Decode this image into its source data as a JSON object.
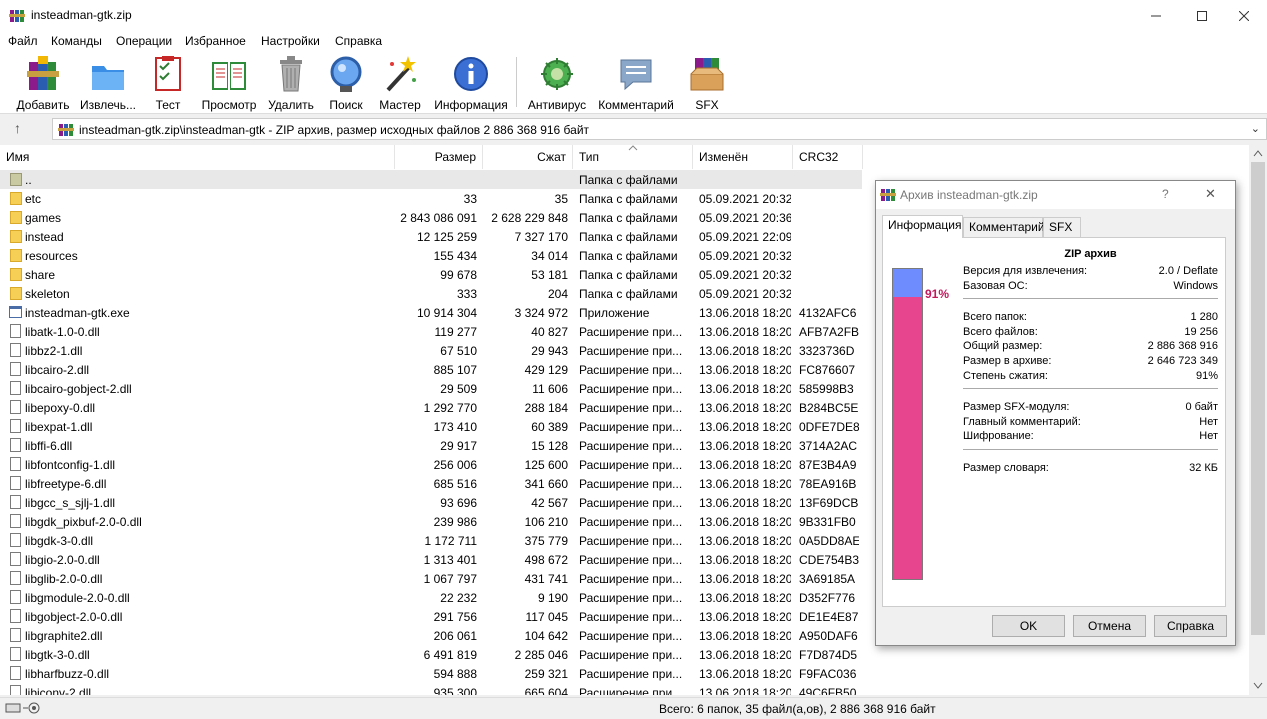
{
  "window": {
    "title": "insteadman-gtk.zip"
  },
  "menu": [
    "Файл",
    "Команды",
    "Операции",
    "Избранное",
    "Настройки",
    "Справка"
  ],
  "toolbar": [
    {
      "label": "Добавить",
      "icon": "add-archive-icon"
    },
    {
      "label": "Извлечь...",
      "icon": "extract-icon"
    },
    {
      "label": "Тест",
      "icon": "test-icon"
    },
    {
      "label": "Просмотр",
      "icon": "view-icon"
    },
    {
      "label": "Удалить",
      "icon": "delete-icon"
    },
    {
      "label": "Поиск",
      "icon": "find-icon"
    },
    {
      "label": "Мастер",
      "icon": "wizard-icon"
    },
    {
      "label": "Информация",
      "icon": "info-icon"
    },
    {
      "label": "Антивирус",
      "icon": "antivirus-icon"
    },
    {
      "label": "Комментарий",
      "icon": "comment-icon"
    },
    {
      "label": "SFX",
      "icon": "sfx-icon"
    }
  ],
  "address": {
    "text": "insteadman-gtk.zip\\insteadman-gtk - ZIP архив, размер исходных файлов 2 886 368 916 байт",
    "up_glyph": "↑",
    "dropdown_glyph": "⌄"
  },
  "columns": [
    "Имя",
    "Размер",
    "Сжат",
    "Тип",
    "Изменён",
    "CRC32"
  ],
  "files": [
    {
      "name": "..",
      "size": "",
      "packed": "",
      "type": "Папка с файлами",
      "modified": "",
      "crc": "",
      "kind": "up"
    },
    {
      "name": "etc",
      "size": "33",
      "packed": "35",
      "type": "Папка с файлами",
      "modified": "05.09.2021 20:32",
      "crc": "",
      "kind": "folder"
    },
    {
      "name": "games",
      "size": "2 843 086 091",
      "packed": "2 628 229 848",
      "type": "Папка с файлами",
      "modified": "05.09.2021 20:36",
      "crc": "",
      "kind": "folder"
    },
    {
      "name": "instead",
      "size": "12 125 259",
      "packed": "7 327 170",
      "type": "Папка с файлами",
      "modified": "05.09.2021 22:09",
      "crc": "",
      "kind": "folder"
    },
    {
      "name": "resources",
      "size": "155 434",
      "packed": "34 014",
      "type": "Папка с файлами",
      "modified": "05.09.2021 20:32",
      "crc": "",
      "kind": "folder"
    },
    {
      "name": "share",
      "size": "99 678",
      "packed": "53 181",
      "type": "Папка с файлами",
      "modified": "05.09.2021 20:32",
      "crc": "",
      "kind": "folder"
    },
    {
      "name": "skeleton",
      "size": "333",
      "packed": "204",
      "type": "Папка с файлами",
      "modified": "05.09.2021 20:32",
      "crc": "",
      "kind": "folder"
    },
    {
      "name": "insteadman-gtk.exe",
      "size": "10 914 304",
      "packed": "3 324 972",
      "type": "Приложение",
      "modified": "13.06.2018 18:20",
      "crc": "4132AFC6",
      "kind": "exe"
    },
    {
      "name": "libatk-1.0-0.dll",
      "size": "119 277",
      "packed": "40 827",
      "type": "Расширение при...",
      "modified": "13.06.2018 18:20",
      "crc": "AFB7A2FB",
      "kind": "file"
    },
    {
      "name": "libbz2-1.dll",
      "size": "67 510",
      "packed": "29 943",
      "type": "Расширение при...",
      "modified": "13.06.2018 18:20",
      "crc": "3323736D",
      "kind": "file"
    },
    {
      "name": "libcairo-2.dll",
      "size": "885 107",
      "packed": "429 129",
      "type": "Расширение при...",
      "modified": "13.06.2018 18:20",
      "crc": "FC876607",
      "kind": "file"
    },
    {
      "name": "libcairo-gobject-2.dll",
      "size": "29 509",
      "packed": "11 606",
      "type": "Расширение при...",
      "modified": "13.06.2018 18:20",
      "crc": "585998B3",
      "kind": "file"
    },
    {
      "name": "libepoxy-0.dll",
      "size": "1 292 770",
      "packed": "288 184",
      "type": "Расширение при...",
      "modified": "13.06.2018 18:20",
      "crc": "B284BC5E",
      "kind": "file"
    },
    {
      "name": "libexpat-1.dll",
      "size": "173 410",
      "packed": "60 389",
      "type": "Расширение при...",
      "modified": "13.06.2018 18:20",
      "crc": "0DFE7DE8",
      "kind": "file"
    },
    {
      "name": "libffi-6.dll",
      "size": "29 917",
      "packed": "15 128",
      "type": "Расширение при...",
      "modified": "13.06.2018 18:20",
      "crc": "3714A2AC",
      "kind": "file"
    },
    {
      "name": "libfontconfig-1.dll",
      "size": "256 006",
      "packed": "125 600",
      "type": "Расширение при...",
      "modified": "13.06.2018 18:20",
      "crc": "87E3B4A9",
      "kind": "file"
    },
    {
      "name": "libfreetype-6.dll",
      "size": "685 516",
      "packed": "341 660",
      "type": "Расширение при...",
      "modified": "13.06.2018 18:20",
      "crc": "78EA916B",
      "kind": "file"
    },
    {
      "name": "libgcc_s_sjlj-1.dll",
      "size": "93 696",
      "packed": "42 567",
      "type": "Расширение при...",
      "modified": "13.06.2018 18:20",
      "crc": "13F69DCB",
      "kind": "file"
    },
    {
      "name": "libgdk_pixbuf-2.0-0.dll",
      "size": "239 986",
      "packed": "106 210",
      "type": "Расширение при...",
      "modified": "13.06.2018 18:20",
      "crc": "9B331FB0",
      "kind": "file"
    },
    {
      "name": "libgdk-3-0.dll",
      "size": "1 172 711",
      "packed": "375 779",
      "type": "Расширение при...",
      "modified": "13.06.2018 18:20",
      "crc": "0A5DD8AE",
      "kind": "file"
    },
    {
      "name": "libgio-2.0-0.dll",
      "size": "1 313 401",
      "packed": "498 672",
      "type": "Расширение при...",
      "modified": "13.06.2018 18:20",
      "crc": "CDE754B3",
      "kind": "file"
    },
    {
      "name": "libglib-2.0-0.dll",
      "size": "1 067 797",
      "packed": "431 741",
      "type": "Расширение при...",
      "modified": "13.06.2018 18:20",
      "crc": "3A69185A",
      "kind": "file"
    },
    {
      "name": "libgmodule-2.0-0.dll",
      "size": "22 232",
      "packed": "9 190",
      "type": "Расширение при...",
      "modified": "13.06.2018 18:20",
      "crc": "D352F776",
      "kind": "file"
    },
    {
      "name": "libgobject-2.0-0.dll",
      "size": "291 756",
      "packed": "117 045",
      "type": "Расширение при...",
      "modified": "13.06.2018 18:20",
      "crc": "DE1E4E87",
      "kind": "file"
    },
    {
      "name": "libgraphite2.dll",
      "size": "206 061",
      "packed": "104 642",
      "type": "Расширение при...",
      "modified": "13.06.2018 18:20",
      "crc": "A950DAF6",
      "kind": "file"
    },
    {
      "name": "libgtk-3-0.dll",
      "size": "6 491 819",
      "packed": "2 285 046",
      "type": "Расширение при...",
      "modified": "13.06.2018 18:20",
      "crc": "F7D874D5",
      "kind": "file"
    },
    {
      "name": "libharfbuzz-0.dll",
      "size": "594 888",
      "packed": "259 321",
      "type": "Расширение при...",
      "modified": "13.06.2018 18:20",
      "crc": "F9FAC036",
      "kind": "file"
    },
    {
      "name": "libiconv-2.dll",
      "size": "935 300",
      "packed": "665 604",
      "type": "Расширение при...",
      "modified": "13.06.2018 18:20",
      "crc": "49C6FB50",
      "kind": "file"
    }
  ],
  "status": {
    "text": "Всего: 6 папок, 35 файл(а,ов), 2 886 368 916 байт"
  },
  "dialog": {
    "title": "Архив insteadman-gtk.zip",
    "help_glyph": "?",
    "close_glyph": "✕",
    "tabs": [
      "Информация",
      "Комментарий",
      "SFX"
    ],
    "heading": "ZIP архив",
    "ratio_label": "91%",
    "ratio_fraction": 0.91,
    "groups": [
      [
        {
          "k": "Версия для извлечения:",
          "v": "2.0 / Deflate"
        },
        {
          "k": "Базовая ОС:",
          "v": "Windows"
        }
      ],
      [
        {
          "k": "Всего папок:",
          "v": "1 280"
        },
        {
          "k": "Всего файлов:",
          "v": "19 256"
        },
        {
          "k": "Общий размер:",
          "v": "2 886 368 916"
        },
        {
          "k": "Размер в архиве:",
          "v": "2 646 723 349"
        },
        {
          "k": "Степень сжатия:",
          "v": "91%"
        }
      ],
      [
        {
          "k": "Размер SFX-модуля:",
          "v": "0 байт"
        },
        {
          "k": "Главный комментарий:",
          "v": "Нет"
        },
        {
          "k": "Шифрование:",
          "v": "Нет"
        }
      ],
      [
        {
          "k": "Размер словаря:",
          "v": "32 КБ"
        }
      ]
    ],
    "buttons": [
      "OK",
      "Отмена",
      "Справка"
    ]
  },
  "colors": {
    "ratio_fill": "#e8458f",
    "ratio_rest": "#6f8cff",
    "folder": "#f6cf57"
  }
}
